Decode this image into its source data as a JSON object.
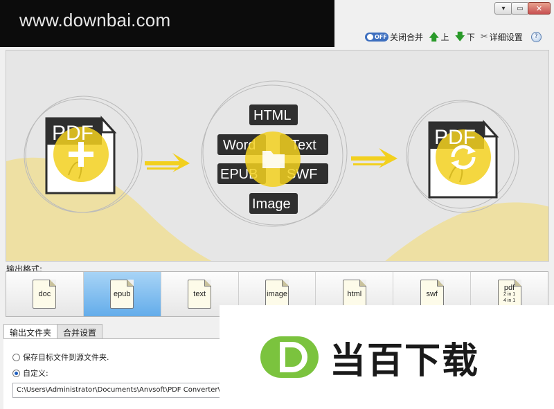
{
  "watermark": {
    "text": "www.downbai.com"
  },
  "window_controls": {
    "minimize": "▾",
    "maximize": "▭",
    "close": "✕"
  },
  "toolbar": {
    "toggle_state": "OFF",
    "merge_label": "关闭合并",
    "up_label": "上",
    "down_label": "下",
    "settings_label": "详细设置"
  },
  "banner": {
    "pdf_label": "PDF",
    "formats": [
      "HTML",
      "Word",
      "Text",
      "EPUB",
      "SWF",
      "Image"
    ],
    "colors": {
      "accent": "#f2d01e",
      "dark": "#2f2f2f",
      "background": "#e6e6e6",
      "wave": "#eee0a3"
    }
  },
  "output_format_label": "输出格式:",
  "formats": [
    {
      "label": "doc",
      "selected": false
    },
    {
      "label": "epub",
      "selected": true
    },
    {
      "label": "text",
      "selected": false
    },
    {
      "label": "image",
      "selected": false
    },
    {
      "label": "html",
      "selected": false
    },
    {
      "label": "swf",
      "selected": false
    },
    {
      "label": "pdf",
      "sub1": "2 in 1",
      "sub2": "4 in 1",
      "selected": false
    }
  ],
  "tabs": [
    {
      "label": "输出文件夹",
      "active": true
    },
    {
      "label": "合并设置",
      "active": false
    }
  ],
  "output_options": {
    "save_to_source_label": "保存目标文件到源文件夹.",
    "custom_label": "自定义:",
    "path_value": "C:\\Users\\Administrator\\Documents\\Anvsoft\\PDF Converter\\output\\"
  },
  "logo": {
    "text": "当百下载",
    "mark": "D",
    "color": "#7bc33e"
  }
}
